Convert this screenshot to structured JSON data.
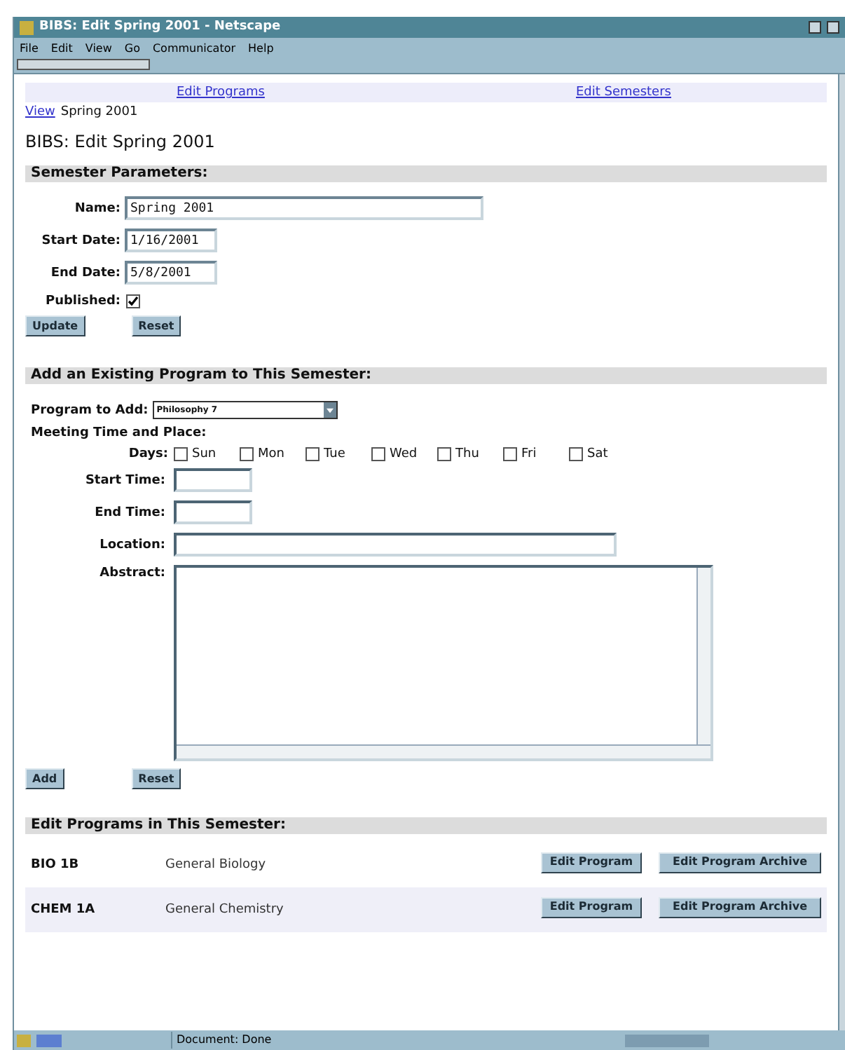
{
  "window": {
    "title": "BIBS: Edit Spring 2001 - Netscape"
  },
  "menu": [
    "File",
    "Edit",
    "View",
    "Go",
    "Communicator",
    "Help"
  ],
  "nav_links": [
    "Edit Programs",
    "Edit Semesters"
  ],
  "breadcrumb": {
    "link": "View",
    "text": "Spring 2001"
  },
  "heading": "BIBS: Edit Spring 2001",
  "semester_parameters": {
    "title": "Semester Parameters:",
    "fields": [
      {
        "label": "Name:",
        "value": "Spring 2001",
        "kind": "wide"
      },
      {
        "label": "Start Date:",
        "value": "1/16/2001",
        "kind": "short"
      },
      {
        "label": "End Date:",
        "value": "5/8/2001",
        "kind": "short"
      }
    ],
    "published": {
      "label": "Published:",
      "checked": true
    },
    "buttons": [
      "Update",
      "Reset"
    ]
  },
  "add_program": {
    "title": "Add an Existing Program to This Semester:",
    "program_label": "Program to Add:",
    "program_value": "Philosophy 7",
    "meeting_label": "Meeting Time and Place:",
    "days_label": "Days:",
    "days": [
      {
        "label": "Sun",
        "checked": false
      },
      {
        "label": "Mon",
        "checked": false
      },
      {
        "label": "Tue",
        "checked": false
      },
      {
        "label": "Wed",
        "checked": false
      },
      {
        "label": "Thu",
        "checked": false
      },
      {
        "label": "Fri",
        "checked": false
      },
      {
        "label": "Sat",
        "checked": false
      }
    ],
    "fields": [
      {
        "label": "Start Time:",
        "kind": "short"
      },
      {
        "label": "End Time:",
        "kind": "short"
      },
      {
        "label": "Location:",
        "kind": "wide"
      }
    ],
    "abstract_label": "Abstract:",
    "buttons": [
      "Add",
      "Reset"
    ]
  },
  "edit_programs": {
    "title": "Edit Programs in This Semester:",
    "rows": [
      {
        "code": "BIO 1B",
        "name": "General Biology",
        "buttons": [
          "Edit Program",
          "Edit Program Archive"
        ]
      },
      {
        "code": "CHEM 1A",
        "name": "General Chemistry",
        "buttons": [
          "Edit Program",
          "Edit Program Archive"
        ]
      }
    ]
  },
  "status_bar": {
    "text": "Document: Done"
  }
}
